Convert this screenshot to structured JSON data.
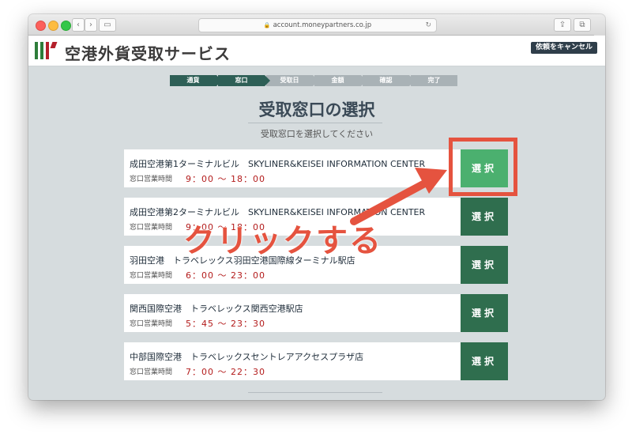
{
  "browser": {
    "url": "account.moneypartners.co.jp",
    "back_label": "‹",
    "forward_label": "›",
    "sidebar_label": "▭",
    "share_label": "⇪",
    "tabs_label": "⧉",
    "reload_label": "↻",
    "new_tab_label": "+"
  },
  "header": {
    "brand": "空港外貨受取サービス",
    "cancel_label": "依頼をキャンセル",
    "logo_colors": [
      "#2e7d3a",
      "#2e7d3a",
      "#b4202a",
      "#b4202a"
    ]
  },
  "steps": [
    {
      "label": "通貨",
      "state": "active"
    },
    {
      "label": "窓口",
      "state": "active"
    },
    {
      "label": "受取日",
      "state": "inactive"
    },
    {
      "label": "金額",
      "state": "inactive"
    },
    {
      "label": "確認",
      "state": "inactive"
    },
    {
      "label": "完了",
      "state": "inactive"
    }
  ],
  "main": {
    "title": "受取窓口の選択",
    "subtitle": "受取窓口を選択してください"
  },
  "windows": [
    {
      "name": "成田空港第1ターミナルビル　SKYLINER&KEISEI INFORMATION CENTER",
      "hours_label": "窓口営業時間",
      "hours": "9：00 〜 18：00",
      "select_label": "選択"
    },
    {
      "name": "成田空港第2ターミナルビル　SKYLINER&KEISEI INFORMATION CENTER",
      "hours_label": "窓口営業時間",
      "hours": "9：00 〜 18：00",
      "select_label": "選択"
    },
    {
      "name": "羽田空港　トラベレックス羽田空港国際線ターミナル駅店",
      "hours_label": "窓口営業時間",
      "hours": "6：00 〜 23：00",
      "select_label": "選択"
    },
    {
      "name": "関西国際空港　トラベレックス関西空港駅店",
      "hours_label": "窓口営業時間",
      "hours": "5：45 〜 23：30",
      "select_label": "選択"
    },
    {
      "name": "中部国際空港　トラベレックスセントレアアクセスプラザ店",
      "hours_label": "窓口営業時間",
      "hours": "7：00 〜 22：30",
      "select_label": "選択"
    }
  ],
  "annotation": {
    "callout_text": "クリックする",
    "color": "#e5533f"
  },
  "colors": {
    "accent_green": "#2f6e4e",
    "highlight_green": "#4bb06f",
    "step_active": "#2e5f56",
    "step_inactive": "#a9b2b6",
    "hours_red": "#b31b1b"
  }
}
